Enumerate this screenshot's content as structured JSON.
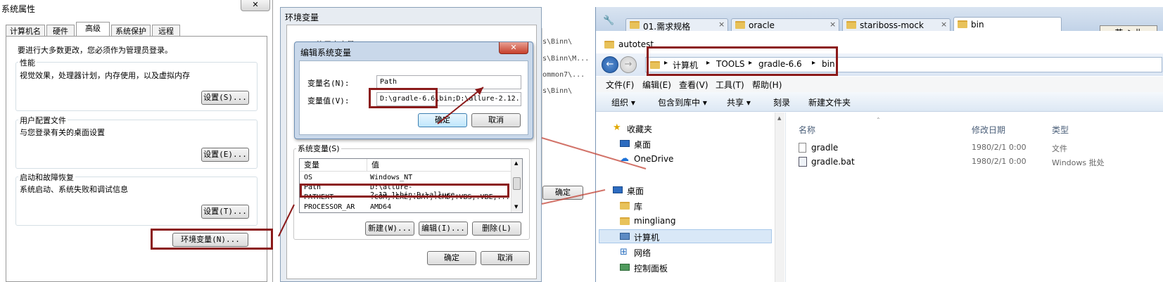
{
  "sysprops": {
    "title": "系统属性",
    "tabs": [
      "计算机名",
      "硬件",
      "高级",
      "系统保护",
      "远程"
    ],
    "admin_note": "要进行大多数更改，您必须作为管理员登录。",
    "perf_label": "性能",
    "perf_desc": "视觉效果，处理器计划，内存使用，以及虚拟内存",
    "settings_s": "设置(S)...",
    "profile_label": "用户配置文件",
    "profile_desc": "与您登录有关的桌面设置",
    "settings_e": "设置(E)...",
    "startup_label": "启动和故障恢复",
    "startup_desc": "系统启动、系统失败和调试信息",
    "settings_t": "设置(T)...",
    "env_button": "环境变量(N)..."
  },
  "envvars": {
    "title": "环境变量",
    "user_vars_label": "的用户变量(U)",
    "sys_vars_label": "系统变量(S)",
    "col_var": "变量",
    "col_val": "值",
    "rows": [
      {
        "name": "OS",
        "value": "Windows_NT"
      },
      {
        "name": "Path",
        "value": "D:\\allure-2.12.1\\bin;D:\\allure-..."
      },
      {
        "name": "PATHEXT",
        "value": ".COM;.EXE;.BAT;.CMD;.VBS;.VBE;..."
      },
      {
        "name": "PROCESSOR_AR",
        "value": "AMD64"
      }
    ],
    "new_btn": "新建(W)...",
    "edit_btn": "编辑(I)...",
    "delete_btn": "删除(L)",
    "ok_btn": "确定",
    "cancel_btn": "取消",
    "bg_lines": [
      "s\\Binn\\",
      "s\\Binn\\M...",
      "ommon7\\...",
      "s\\Binn\\"
    ]
  },
  "editdialog": {
    "title": "编辑系统变量",
    "name_label": "变量名(N):",
    "name_value": "Path",
    "value_label": "变量值(V):",
    "value_value": "D:\\gradle-6.6\\bin;D:\\allure-2.12.1\\l",
    "ok_btn": "确定",
    "cancel_btn": "取消"
  },
  "bgdialog": {
    "ok_btn": "确定"
  },
  "explorer": {
    "tabs": [
      "01.需求规格",
      "oracle",
      "stariboss-mock",
      "bin"
    ],
    "tab_close": "×",
    "ime_text": "英 ♪ 卝",
    "folder_title": "autotest",
    "breadcrumb": [
      "计算机",
      "TOOLS",
      "gradle-6.6",
      "bin"
    ],
    "menu": [
      "文件(F)",
      "编辑(E)",
      "查看(V)",
      "工具(T)",
      "帮助(H)"
    ],
    "toolbar": [
      "组织 ▾",
      "包含到库中 ▾",
      "共享 ▾",
      "刻录",
      "新建文件夹"
    ],
    "sidebar": [
      "收藏夹",
      "桌面",
      "OneDrive",
      "桌面",
      "库",
      "mingliang",
      "计算机",
      "网络",
      "控制面板"
    ],
    "columns": [
      "名称",
      "修改日期",
      "类型"
    ],
    "files": [
      {
        "name": "gradle",
        "date": "1980/2/1 0:00",
        "type": "文件"
      },
      {
        "name": "gradle.bat",
        "date": "1980/2/1 0:00",
        "type": "Windows 批处"
      }
    ]
  }
}
